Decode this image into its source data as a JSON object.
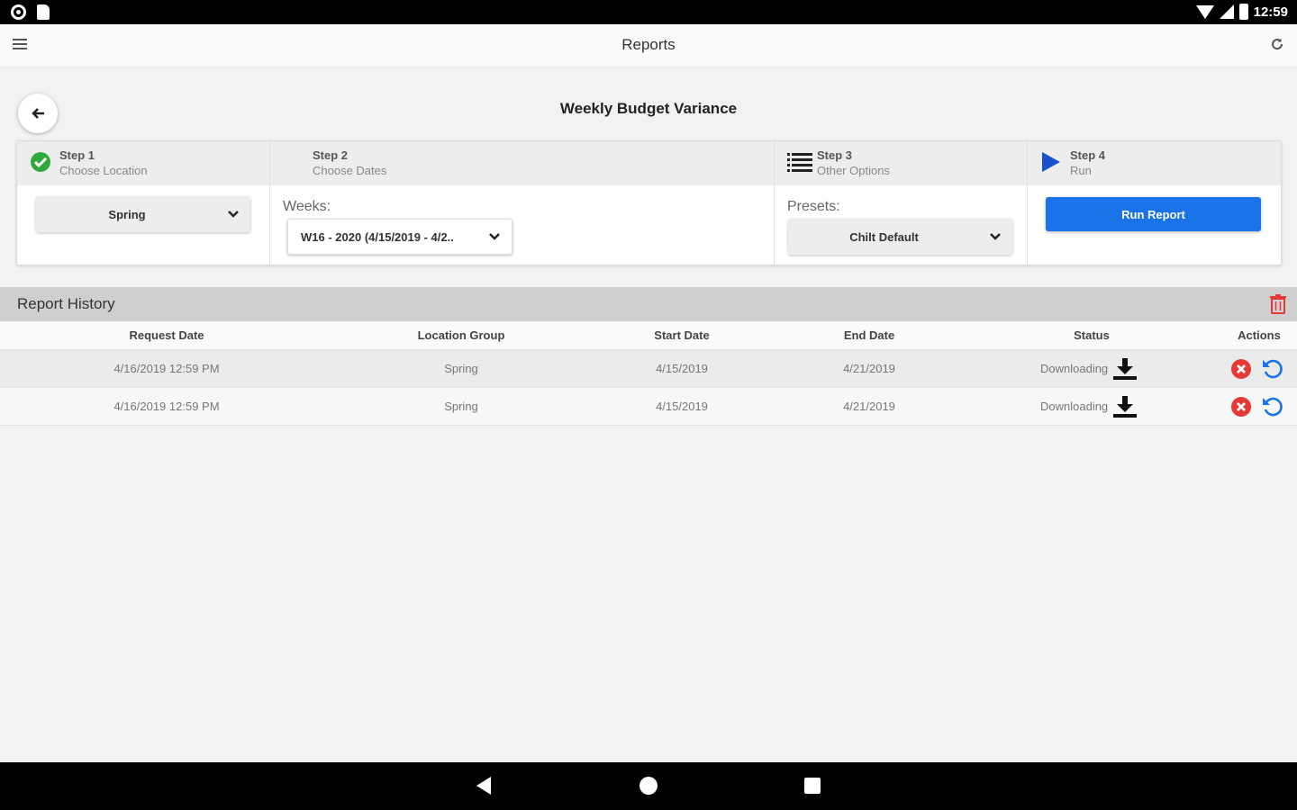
{
  "status_bar": {
    "time": "12:59"
  },
  "app_bar": {
    "title": "Reports"
  },
  "report": {
    "title": "Weekly Budget Variance"
  },
  "steps": [
    {
      "number": "Step 1",
      "description": "Choose Location",
      "icon": "globe-check-icon"
    },
    {
      "number": "Step 2",
      "description": "Choose Dates"
    },
    {
      "number": "Step 3",
      "description": "Other Options",
      "icon": "list-icon"
    },
    {
      "number": "Step 4",
      "description": "Run",
      "icon": "play-icon"
    }
  ],
  "location_select": {
    "value": "Spring"
  },
  "weeks": {
    "label": "Weeks:",
    "value": "W16 - 2020 (4/15/2019 - 4/2.."
  },
  "presets": {
    "label": "Presets:",
    "value": "Chilt Default"
  },
  "run_button": {
    "label": "Run Report"
  },
  "history": {
    "title": "Report History",
    "columns": [
      "Request Date",
      "Location Group",
      "Start Date",
      "End Date",
      "Status",
      "Actions"
    ],
    "rows": [
      {
        "request_date": "4/16/2019 12:59 PM",
        "location_group": "Spring",
        "start_date": "4/15/2019",
        "end_date": "4/21/2019",
        "status": "Downloading"
      },
      {
        "request_date": "4/16/2019 12:59 PM",
        "location_group": "Spring",
        "start_date": "4/15/2019",
        "end_date": "4/21/2019",
        "status": "Downloading"
      }
    ]
  },
  "colors": {
    "accent": "#1a73e8",
    "delete": "#e53935",
    "success": "#2eaa3c",
    "header_gray": "#cfcfcf"
  }
}
